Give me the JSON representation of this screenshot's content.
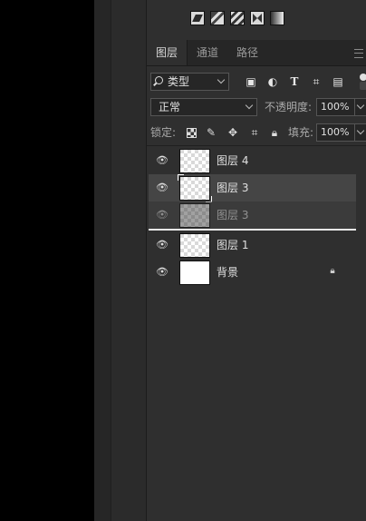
{
  "tabs": [
    {
      "label": "图层",
      "active": true
    },
    {
      "label": "通道",
      "active": false
    },
    {
      "label": "路径",
      "active": false
    }
  ],
  "filter": {
    "kind_label": "类型",
    "icons": [
      "image-filter-icon",
      "adjustment-filter-icon",
      "type-filter-icon",
      "shape-filter-icon",
      "smart-object-filter-icon"
    ]
  },
  "blend": {
    "mode": "正常",
    "opacity_label": "不透明度:",
    "opacity_value": "100%"
  },
  "lock": {
    "label": "锁定:",
    "fill_label": "填充:",
    "fill_value": "100%"
  },
  "layers": [
    {
      "name": "图层 4",
      "thumb": "transparent",
      "selected": false
    },
    {
      "name": "图层 3",
      "thumb": "transparent",
      "selected": true
    },
    {
      "name": "图层 3",
      "thumb": "transparent",
      "selected": true,
      "dragging": true
    },
    {
      "name": "图层 1",
      "thumb": "transparent",
      "selected": false
    },
    {
      "name": "背景",
      "thumb": "white",
      "selected": false,
      "locked": true
    }
  ],
  "colors": {
    "panel": "#2f2f2f",
    "selected": "#454545",
    "canvas": "#000000"
  }
}
